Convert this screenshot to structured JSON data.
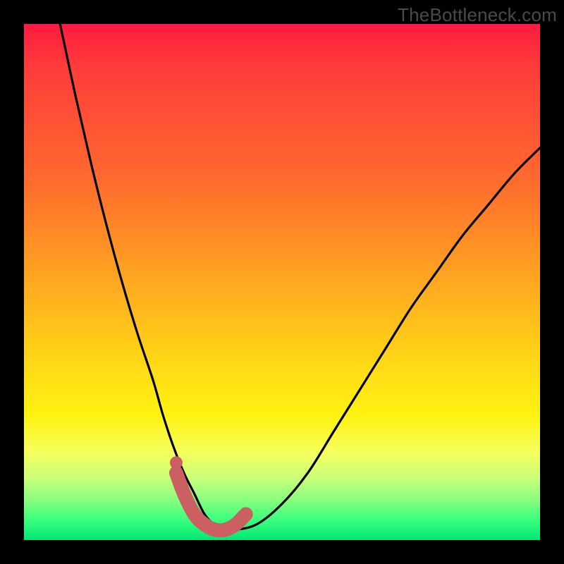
{
  "watermark": "TheBottleneck.com",
  "colors": {
    "background": "#000000",
    "gradient_top": "#ff1a40",
    "gradient_mid1": "#ff6a2e",
    "gradient_mid2": "#ffd916",
    "gradient_bottom": "#00e874",
    "curve": "#000000",
    "highlight": "#cb5f62"
  },
  "chart_data": {
    "type": "line",
    "title": "",
    "xlabel": "",
    "ylabel": "",
    "xlim": [
      0,
      100
    ],
    "ylim": [
      0,
      100
    ],
    "series": [
      {
        "name": "bottleneck-curve",
        "x": [
          7,
          10,
          13,
          16,
          19,
          22,
          25,
          27,
          29,
          31,
          33,
          35,
          37,
          40,
          45,
          50,
          55,
          60,
          65,
          70,
          75,
          80,
          85,
          90,
          95,
          100
        ],
        "y": [
          100,
          86,
          73,
          61,
          50,
          40,
          31,
          24,
          18,
          13,
          9,
          5,
          3,
          2,
          3,
          7,
          13,
          21,
          29,
          37,
          45,
          52,
          59,
          65,
          71,
          76
        ]
      }
    ],
    "highlight_segment": {
      "name": "valley-highlight",
      "points_xy": [
        [
          29.5,
          13
        ],
        [
          31,
          9
        ],
        [
          33,
          5
        ],
        [
          35,
          3
        ],
        [
          37,
          2
        ],
        [
          39,
          2
        ],
        [
          41,
          3
        ],
        [
          43,
          5
        ]
      ],
      "dot_xy": [
        29.5,
        15
      ]
    }
  }
}
